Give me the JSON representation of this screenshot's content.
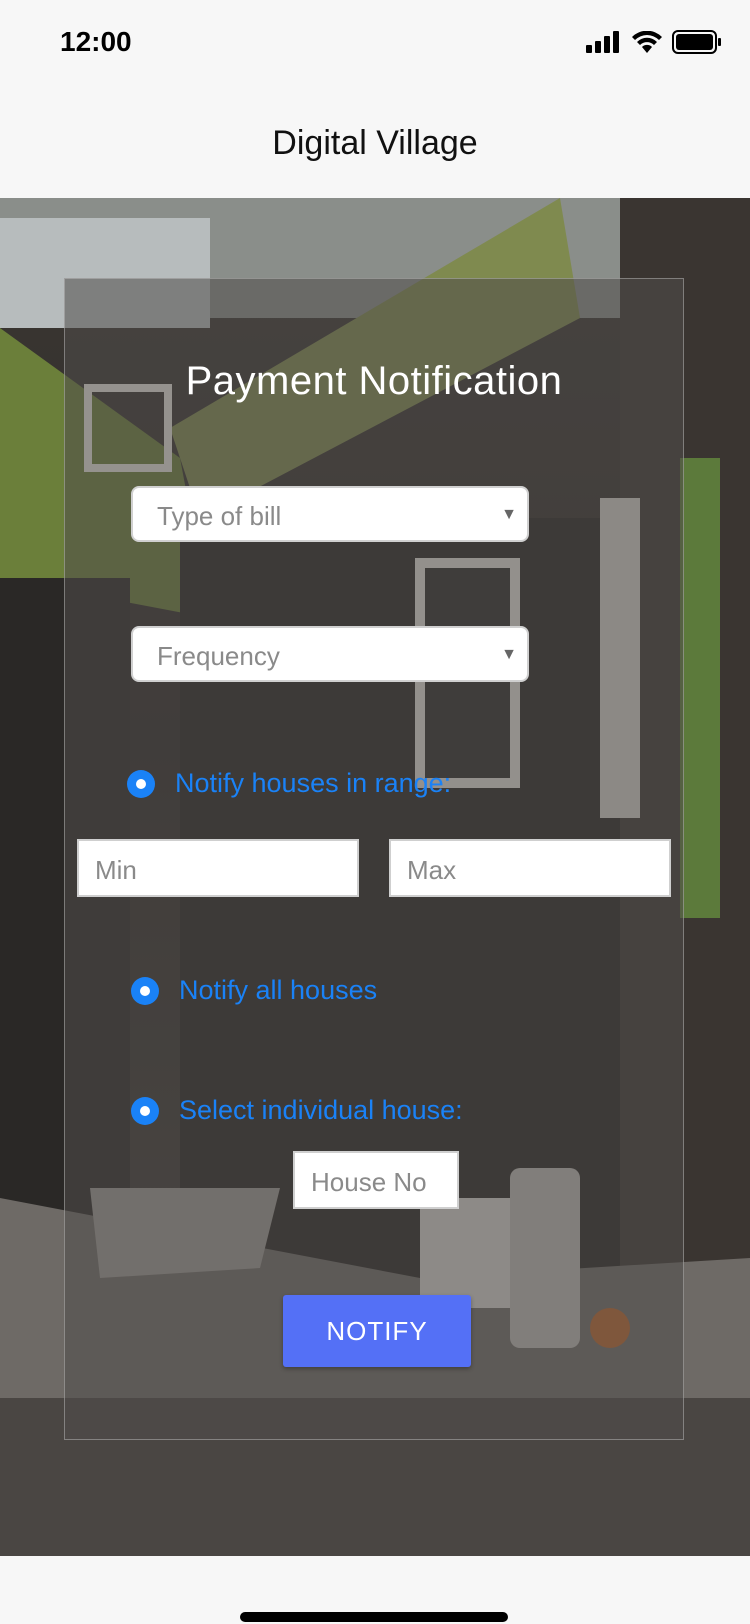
{
  "status_bar": {
    "time": "12:00"
  },
  "nav": {
    "title": "Digital Village"
  },
  "form": {
    "title": "Payment Notification",
    "bill_type": {
      "placeholder": "Type of bill"
    },
    "frequency": {
      "placeholder": "Frequency"
    },
    "range_option": {
      "label": "Notify houses in range:"
    },
    "min": {
      "placeholder": "Min"
    },
    "max": {
      "placeholder": "Max"
    },
    "all_option": {
      "label": "Notify all houses"
    },
    "individual_option": {
      "label": "Select individual house:"
    },
    "house_no": {
      "placeholder": "House No"
    },
    "submit_label": "NOTIFY"
  },
  "colors": {
    "accent": "#1a82f7",
    "button": "#5470f6"
  }
}
